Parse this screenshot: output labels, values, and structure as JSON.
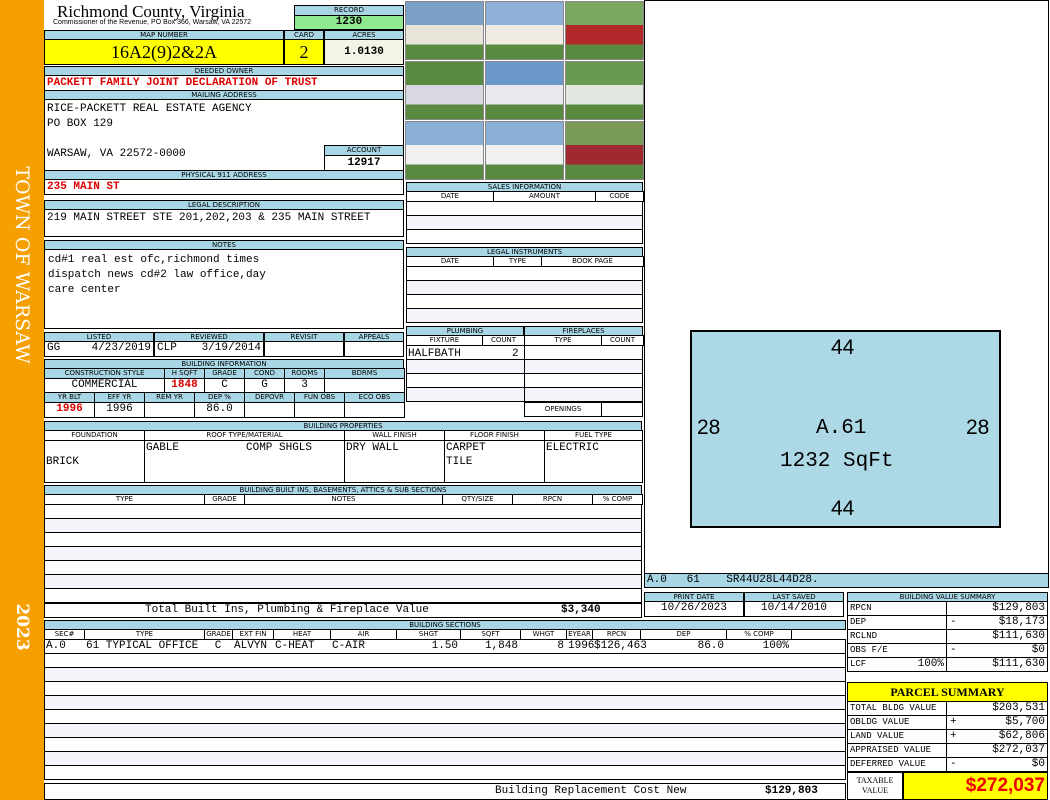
{
  "side": {
    "town": "TOWN OF WARSAW",
    "year": "2023"
  },
  "header": {
    "county": "Richmond County, Virginia",
    "office": "Commissioner of the Revenue, PO Box 366, Warsaw, VA 22572",
    "record_label": "RECORD",
    "record": "1230",
    "map_label": "MAP NUMBER",
    "map": "16A2(9)2&2A",
    "card_label": "CARD",
    "card": "2",
    "acres_label": "ACRES",
    "acres": "1.0130"
  },
  "owner": {
    "label": "DEEDED OWNER",
    "value": "PACKETT FAMILY JOINT DECLARATION OF TRUST"
  },
  "mailing": {
    "label": "MAILING ADDRESS",
    "line1": "RICE-PACKETT REAL ESTATE AGENCY",
    "line2": "PO BOX 129",
    "line3": "WARSAW, VA 22572-0000",
    "account_label": "ACCOUNT",
    "account": "12917"
  },
  "physical": {
    "label": "PHYSICAL 911 ADDRESS",
    "value": "235 MAIN ST"
  },
  "legal": {
    "label": "LEGAL DESCRIPTION",
    "value": "219 MAIN STREET STE 201,202,203 & 235 MAIN STREET"
  },
  "notes": {
    "label": "NOTES",
    "lines": [
      "cd#1 real est ofc,richmond times",
      "dispatch news cd#2 law office,day",
      "care center"
    ]
  },
  "listing": {
    "listed_label": "LISTED",
    "listed_by": "GG",
    "listed_date": "4/23/2019",
    "reviewed_label": "REVIEWED",
    "reviewed_by": "CLP",
    "reviewed_date": "3/19/2014",
    "revisit_label": "REVISIT",
    "appeals_label": "APPEALS"
  },
  "building_info": {
    "label": "BUILDING INFORMATION",
    "h1": [
      "CONSTRUCTION STYLE",
      "H SQFT",
      "GRADE",
      "COND",
      "ROOMS",
      "BDRMS"
    ],
    "v1": [
      "COMMERCIAL",
      "1848",
      "C",
      "G",
      "3",
      ""
    ],
    "h2": [
      "YR BLT",
      "EFF YR",
      "REM YR",
      "DEP %",
      "DEPOVR",
      "FUN OBS",
      "ECO OBS"
    ],
    "v2": [
      "1996",
      "1996",
      "",
      "86.0",
      "",
      "",
      ""
    ]
  },
  "sales": {
    "label": "SALES INFORMATION",
    "cols": [
      "DATE",
      "AMOUNT",
      "CODE"
    ]
  },
  "instruments": {
    "label": "LEGAL INSTRUMENTS",
    "cols": [
      "DATE",
      "TYPE",
      "BOOK PAGE"
    ]
  },
  "plumbing": {
    "label": "PLUMBING",
    "cols": [
      "FIXTURE",
      "COUNT"
    ],
    "fixture": "HALFBATH",
    "count": "2"
  },
  "fireplaces": {
    "label": "FIREPLACES",
    "cols": [
      "TYPE",
      "COUNT"
    ],
    "openings": "OPENINGS"
  },
  "properties": {
    "label": "BUILDING PROPERTIES",
    "cols": [
      "FOUNDATION",
      "ROOF TYPE/MATERIAL",
      "WALL FINISH",
      "FLOOR FINISH",
      "FUEL TYPE"
    ],
    "foundation": "BRICK",
    "roof_type": "GABLE",
    "roof_material": "COMP SHGLS",
    "wall": "DRY WALL",
    "floor1": "CARPET",
    "floor2": "TILE",
    "fuel": "ELECTRIC"
  },
  "builtins": {
    "label": "BUILDING BUILT INS, BASEMENTS, ATTICS & SUB SECTIONS",
    "cols": [
      "TYPE",
      "GRADE",
      "NOTES",
      "QTY/SIZE",
      "RPCN",
      "% COMP"
    ],
    "total_label": "Total Built Ins, Plumbing & Fireplace Value",
    "total": "$3,340"
  },
  "sections": {
    "label": "BUILDING SECTIONS",
    "cols": [
      "SEC#",
      "TYPE",
      "GRADE",
      "EXT FIN",
      "HEAT",
      "AIR",
      "SHGT",
      "SQFT",
      "WHGT",
      "EYEAR",
      "RPCN",
      "DEP",
      "% COMP"
    ],
    "row": [
      "A.0",
      "61 TYPICAL OFFICE",
      "C",
      "ALVYN",
      "C-HEAT",
      "C-AIR",
      "1.50",
      "1,848",
      "8",
      "1996",
      "$126,463",
      "86.0",
      "100%"
    ],
    "rcn_label": "Building Replacement Cost New",
    "rcn": "$129,803"
  },
  "sketch": {
    "top": "44",
    "bottom": "44",
    "left": "28",
    "right": "28",
    "code": "A.61",
    "area": "1232 SqFt",
    "footer": "A.0   61    SR44U28L44D28."
  },
  "dates": {
    "print_label": "PRINT DATE",
    "print": "10/26/2023",
    "saved_label": "LAST SAVED",
    "saved": "10/14/2010"
  },
  "value_summary": {
    "label": "BUILDING VALUE SUMMARY",
    "rows": [
      {
        "k": "RPCN",
        "s": "",
        "v": "$129,803"
      },
      {
        "k": "DEP",
        "s": "-",
        "v": "$18,173"
      },
      {
        "k": "RCLND",
        "s": "",
        "v": "$111,630"
      },
      {
        "k": "OBS F/E",
        "s": "-",
        "v": "$0"
      },
      {
        "k": "LCF",
        "p": "100%",
        "s": "",
        "v": "$111,630"
      }
    ]
  },
  "parcel": {
    "label": "PARCEL SUMMARY",
    "rows": [
      {
        "k": "TOTAL BLDG VALUE",
        "s": "",
        "v": "$203,531"
      },
      {
        "k": "OBLDG VALUE",
        "s": "+",
        "v": "$5,700"
      },
      {
        "k": "LAND VALUE",
        "s": "+",
        "v": "$62,806"
      },
      {
        "k": "APPRAISED VALUE",
        "s": "",
        "v": "$272,037"
      },
      {
        "k": "DEFERRED VALUE",
        "s": "-",
        "v": "$0"
      }
    ],
    "taxable_label": "TAXABLE VALUE",
    "taxable": "$272,037"
  },
  "colors": {
    "side": "#f5a000",
    "header": "#a9d6e5",
    "yellow": "#ffff00",
    "green": "#90e890"
  }
}
